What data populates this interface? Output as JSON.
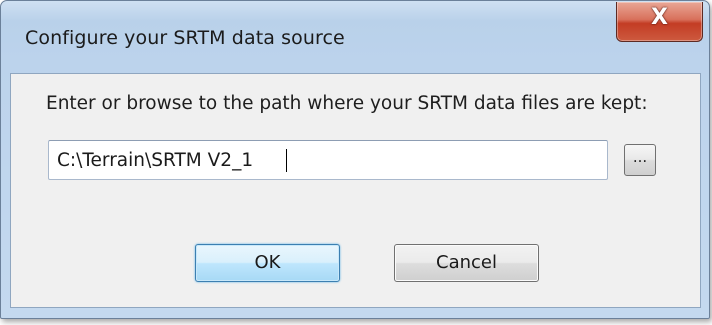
{
  "window": {
    "title": "Configure your SRTM data source",
    "close_glyph": "X"
  },
  "content": {
    "prompt": "Enter or browse to the path where your SRTM data files are kept:",
    "path_value": "C:\\Terrain\\SRTM V2_1",
    "browse_label": "..."
  },
  "buttons": {
    "ok_label": "OK",
    "cancel_label": "Cancel"
  },
  "icons": {
    "close": "close-icon"
  },
  "colors": {
    "title_bar": "#b9d1ea",
    "close_button": "#c33c24",
    "client_bg": "#f0f0f0",
    "default_button": "#bee6fd"
  }
}
